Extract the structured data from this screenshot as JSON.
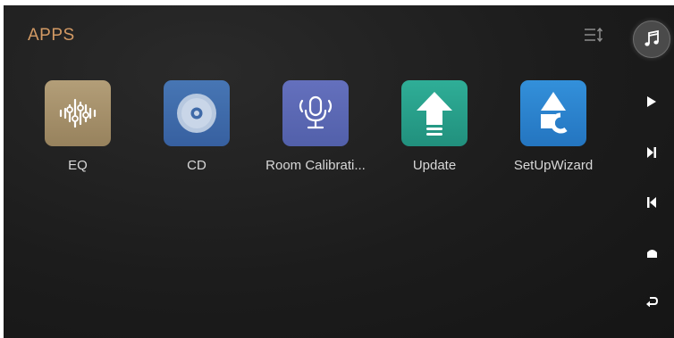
{
  "header": {
    "title": "APPS",
    "title_color": "#d39a64",
    "sort_icon": "sort-lines-icon"
  },
  "apps": [
    {
      "label": "EQ",
      "icon": "equalizer-icon",
      "color": "#a48e6a"
    },
    {
      "label": "CD",
      "icon": "cd-disc-icon",
      "color": "#3f6aa8"
    },
    {
      "label": "Room Calibrati...",
      "icon": "microphone-icon",
      "color": "#5a67b3"
    },
    {
      "label": "Update",
      "icon": "upload-arrow-icon",
      "color": "#279e8a"
    },
    {
      "label": "SetUpWizard",
      "icon": "shapes-wizard-icon",
      "color": "#2a83cf"
    }
  ],
  "side_rail": {
    "buttons": [
      "music-note-icon",
      "play-icon",
      "next-track-icon",
      "previous-track-icon",
      "home-icon",
      "back-icon"
    ]
  }
}
